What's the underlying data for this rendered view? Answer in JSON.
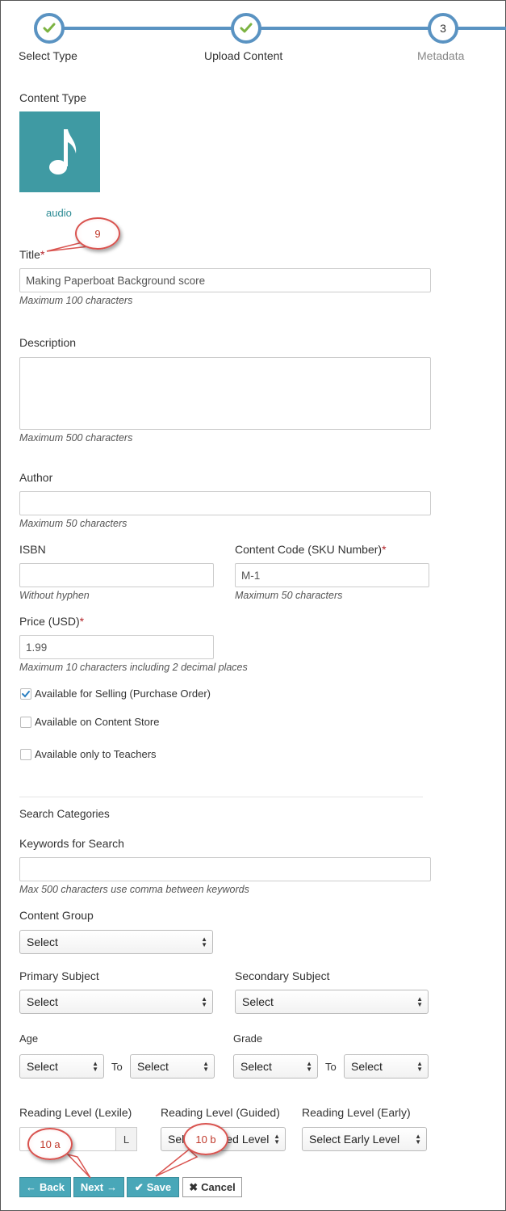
{
  "stepper": {
    "steps": [
      {
        "label": "Select Type",
        "state": "done"
      },
      {
        "label": "Upload Content",
        "state": "done"
      },
      {
        "label": "Metadata",
        "state": "current",
        "number": "3"
      }
    ]
  },
  "content_type": {
    "label": "Content Type",
    "icon": "music-note-icon",
    "tile_color": "#3f9aa3",
    "name": "audio"
  },
  "title": {
    "label": "Title",
    "required": "*",
    "value": "Making Paperboat Background score",
    "hint": "Maximum 100 characters"
  },
  "description": {
    "label": "Description",
    "value": "",
    "hint": "Maximum 500 characters"
  },
  "author": {
    "label": "Author",
    "value": "",
    "hint": "Maximum 50 characters"
  },
  "isbn": {
    "label": "ISBN",
    "value": "",
    "hint": "Without hyphen"
  },
  "content_code": {
    "label": "Content Code (SKU Number)",
    "required": "*",
    "value": "M-1",
    "hint": "Maximum 50 characters"
  },
  "price": {
    "label": "Price (USD)",
    "required": "*",
    "value": "1.99",
    "hint": "Maximum 10 characters including 2 decimal places"
  },
  "checkboxes": [
    {
      "label": "Available for Selling (Purchase Order)",
      "checked": true
    },
    {
      "label": "Available on Content Store",
      "checked": false
    },
    {
      "label": "Available only to Teachers",
      "checked": false
    }
  ],
  "search": {
    "heading": "Search Categories",
    "keywords_label": "Keywords for Search",
    "keywords_value": "",
    "keywords_hint": "Max 500 characters use comma between keywords"
  },
  "content_group": {
    "label": "Content Group",
    "value": "Select"
  },
  "primary_subject": {
    "label": "Primary Subject",
    "value": "Select"
  },
  "secondary_subject": {
    "label": "Secondary Subject",
    "value": "Select"
  },
  "age": {
    "label": "Age",
    "from": "Select",
    "to_label": "To",
    "to": "Select"
  },
  "grade": {
    "label": "Grade",
    "from": "Select",
    "to_label": "To",
    "to": "Select"
  },
  "reading_lexile": {
    "label": "Reading Level (Lexile)",
    "value": "",
    "addon": "L"
  },
  "reading_guided": {
    "label": "Reading Level (Guided)",
    "value": "Select Guided Level"
  },
  "reading_early": {
    "label": "Reading Level (Early)",
    "value": "Select Early Level"
  },
  "buttons": {
    "back": "Back",
    "next": "Next",
    "save": "Save",
    "cancel": "Cancel"
  },
  "callouts": {
    "c9": "9",
    "c10a": "10 a",
    "c10b": "10 b"
  },
  "colors": {
    "accent": "#5a93c2",
    "button": "#49a7b8",
    "check": "#7cb342",
    "required": "#b3242a",
    "callout": "#d9534f"
  }
}
